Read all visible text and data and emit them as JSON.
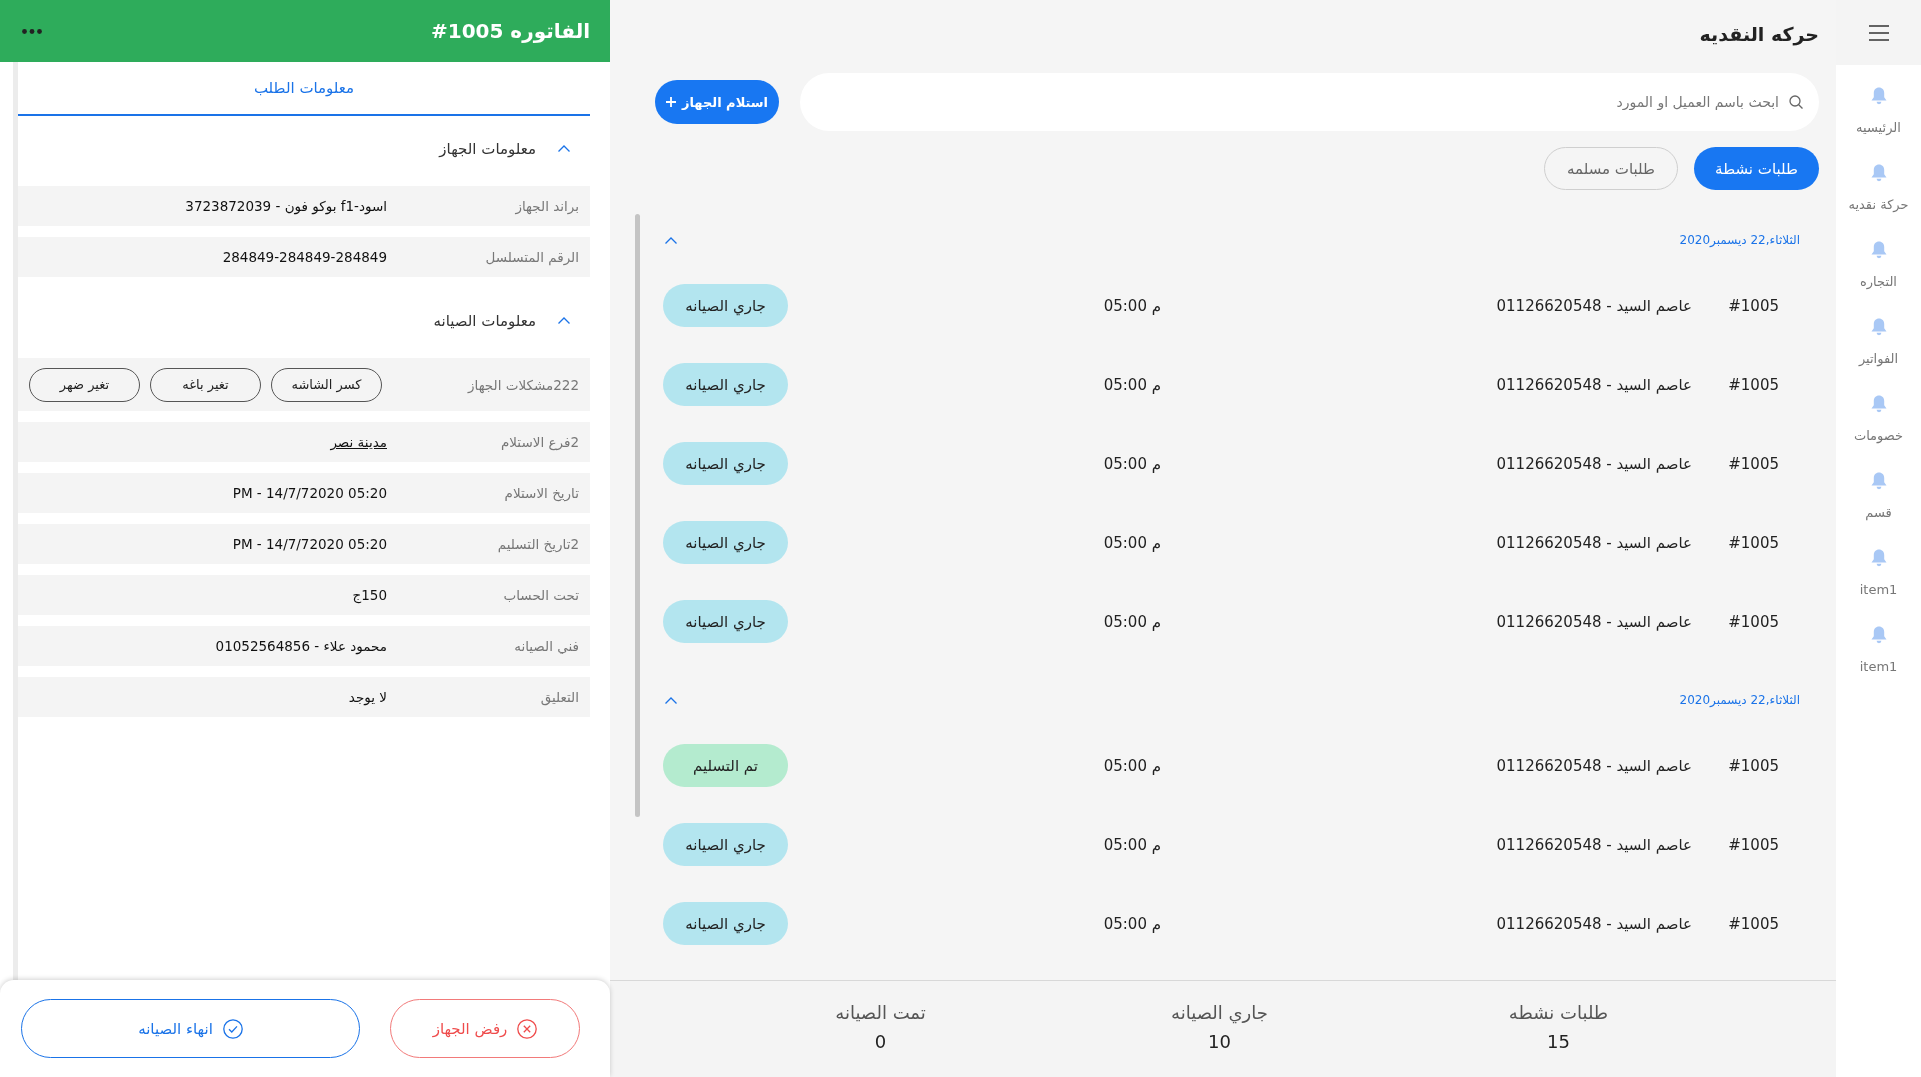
{
  "sidebar": {
    "items": [
      {
        "label": "الرئيسيه"
      },
      {
        "label": "حركة نقديه"
      },
      {
        "label": "التجاره"
      },
      {
        "label": "الفواتير"
      },
      {
        "label": "خصومات"
      },
      {
        "label": "قسم"
      },
      {
        "label": "item1"
      },
      {
        "label": "item1"
      }
    ]
  },
  "main": {
    "title": "حركه النقديه",
    "search": {
      "placeholder": "ابحث باسم العميل او المورد"
    },
    "add_button": "استلام الجهاز",
    "tabs": [
      {
        "label": "طلبات نشطة",
        "selected": true
      },
      {
        "label": "طلبات مسلمه",
        "selected": false
      }
    ],
    "groups": [
      {
        "date": "الثلاثاء,22 ديسمبر2020",
        "expanded": true,
        "orders": [
          {
            "number": "#1005",
            "customer": "عاصم السيد - 01126620548",
            "time": "05:00 م",
            "status": "جاري الصيانه",
            "color": "#b3e5ef"
          },
          {
            "number": "#1005",
            "customer": "عاصم السيد - 01126620548",
            "time": "05:00 م",
            "status": "جاري الصيانه",
            "color": "#b3e5ef"
          },
          {
            "number": "#1005",
            "customer": "عاصم السيد - 01126620548",
            "time": "05:00 م",
            "status": "جاري الصيانه",
            "color": "#b3e5ef"
          },
          {
            "number": "#1005",
            "customer": "عاصم السيد - 01126620548",
            "time": "05:00 م",
            "status": "جاري الصيانه",
            "color": "#b3e5ef"
          },
          {
            "number": "#1005",
            "customer": "عاصم السيد - 01126620548",
            "time": "05:00 م",
            "status": "جاري الصيانه",
            "color": "#b3e5ef"
          }
        ]
      },
      {
        "date": "الثلاثاء,22 ديسمبر2020",
        "expanded": true,
        "orders": [
          {
            "number": "#1005",
            "customer": "عاصم السيد - 01126620548",
            "time": "05:00 م",
            "status": "تم التسليم",
            "color": "#b4ebcf"
          },
          {
            "number": "#1005",
            "customer": "عاصم السيد - 01126620548",
            "time": "05:00 م",
            "status": "جاري الصيانه",
            "color": "#b3e5ef"
          },
          {
            "number": "#1005",
            "customer": "عاصم السيد - 01126620548",
            "time": "05:00 م",
            "status": "جاري الصيانه",
            "color": "#b3e5ef"
          }
        ]
      }
    ],
    "stats": [
      {
        "label": "طلبات نشطه",
        "value": "15"
      },
      {
        "label": "جاري الصيانه",
        "value": "10"
      },
      {
        "label": "تمت الصيانه",
        "value": "0"
      }
    ]
  },
  "invoice_panel": {
    "title": "#1005 الفاتوره",
    "tab": {
      "label": "معلومات الطلب",
      "selected": true
    },
    "sections": [
      {
        "title": "معلومات الجهاز",
        "expanded": true,
        "rows": [
          {
            "kind": "text",
            "label": "براند الجهاز",
            "value": "اسود-f1 بوكو فون - 3723872039"
          },
          {
            "kind": "text",
            "label": "الرقم المتسلسل",
            "value": "284849-284849-284849"
          }
        ]
      },
      {
        "title": "معلومات الصيانه",
        "expanded": true,
        "rows": [
          {
            "kind": "tags",
            "label": "222مشكلات الجهاز",
            "tags": [
              "كسر الشاشه",
              "تغير باغه",
              "تغير ضهر"
            ]
          },
          {
            "kind": "link",
            "label": "2فرع الاستلام",
            "value": "مدينة نصر"
          },
          {
            "kind": "latin",
            "label": "تاريخ الاستلام",
            "value": "PM - 14/7/72020 05:20"
          },
          {
            "kind": "latin",
            "label": "2تاريخ التسليم",
            "value": "PM - 14/7/72020 05:20"
          },
          {
            "kind": "text",
            "label": "تحت الحساب",
            "value": "150ج"
          },
          {
            "kind": "text",
            "label": "فني الصيانه",
            "value": "محمود علاء - 01052564856"
          },
          {
            "kind": "text",
            "label": "التعليق",
            "value": "لا يوجد"
          }
        ]
      }
    ],
    "actions": [
      {
        "kind": "reject",
        "label": "رفض الجهاز"
      },
      {
        "kind": "finish",
        "label": "انهاء الصيانه"
      }
    ]
  }
}
